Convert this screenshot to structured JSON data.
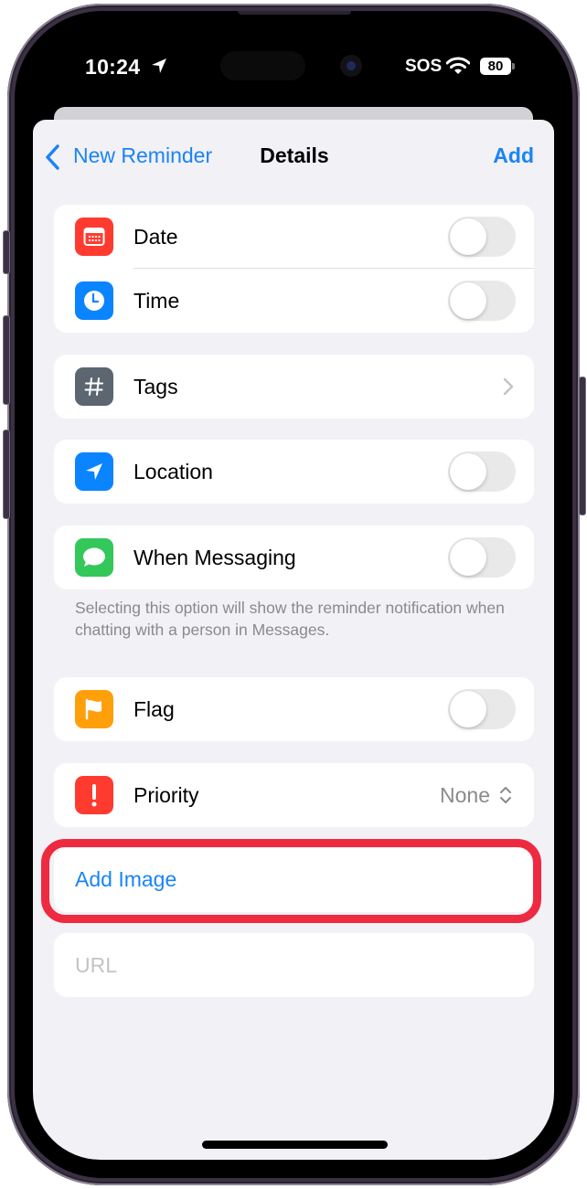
{
  "status_bar": {
    "time": "10:24",
    "carrier": "SOS",
    "battery": "80"
  },
  "nav": {
    "back_label": "New Reminder",
    "title": "Details",
    "add_label": "Add"
  },
  "groups": {
    "date_time": [
      {
        "label": "Date",
        "icon": "calendar-icon",
        "icon_color": "#ff3b30",
        "toggle_on": false
      },
      {
        "label": "Time",
        "icon": "clock-icon",
        "icon_color": "#0a84ff",
        "toggle_on": false
      }
    ],
    "tags": {
      "label": "Tags",
      "icon": "hashtag-icon",
      "icon_color": "#5b6670"
    },
    "location": {
      "label": "Location",
      "icon": "location-arrow-icon",
      "icon_color": "#0a84ff",
      "toggle_on": false
    },
    "messaging": {
      "label": "When Messaging",
      "icon": "message-bubble-icon",
      "icon_color": "#34c759",
      "toggle_on": false,
      "footnote": "Selecting this option will show the reminder notification when chatting with a person in Messages."
    },
    "flag": {
      "label": "Flag",
      "icon": "flag-icon",
      "icon_color": "#ff9f0a",
      "toggle_on": false
    },
    "priority": {
      "label": "Priority",
      "icon": "exclamation-icon",
      "icon_color": "#ff3b30",
      "value": "None"
    }
  },
  "add_image": {
    "label": "Add Image",
    "highlight_color": "#ee2a41"
  },
  "url": {
    "placeholder": "URL",
    "value": ""
  },
  "colors": {
    "accent": "#1a84f5",
    "background": "#f2f1f6"
  }
}
